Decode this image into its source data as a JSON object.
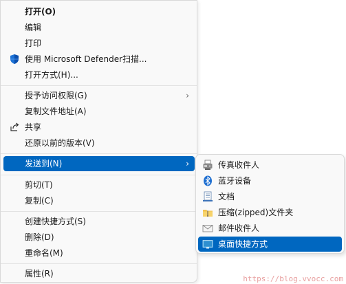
{
  "menu": {
    "items": [
      {
        "label": "打开(O)"
      },
      {
        "label": "编辑"
      },
      {
        "label": "打印"
      },
      {
        "label": "使用 Microsoft Defender扫描..."
      },
      {
        "label": "打开方式(H)..."
      },
      {
        "label": "授予访问权限(G)"
      },
      {
        "label": "复制文件地址(A)"
      },
      {
        "label": "共享"
      },
      {
        "label": "还原以前的版本(V)"
      },
      {
        "label": "发送到(N)"
      },
      {
        "label": "剪切(T)"
      },
      {
        "label": "复制(C)"
      },
      {
        "label": "创建快捷方式(S)"
      },
      {
        "label": "删除(D)"
      },
      {
        "label": "重命名(M)"
      },
      {
        "label": "属性(R)"
      }
    ],
    "chevron": "›"
  },
  "submenu": {
    "items": [
      {
        "label": "传真收件人",
        "icon": "fax-icon"
      },
      {
        "label": "蓝牙设备",
        "icon": "bluetooth-icon"
      },
      {
        "label": "文档",
        "icon": "document-icon"
      },
      {
        "label": "压缩(zipped)文件夹",
        "icon": "zip-folder-icon"
      },
      {
        "label": "邮件收件人",
        "icon": "mail-icon"
      },
      {
        "label": "桌面快捷方式",
        "icon": "desktop-icon"
      }
    ]
  },
  "watermark": "https://blog.vvocc.com",
  "colors": {
    "highlight": "#0067c0",
    "menu_bg": "#f9f9f9"
  }
}
